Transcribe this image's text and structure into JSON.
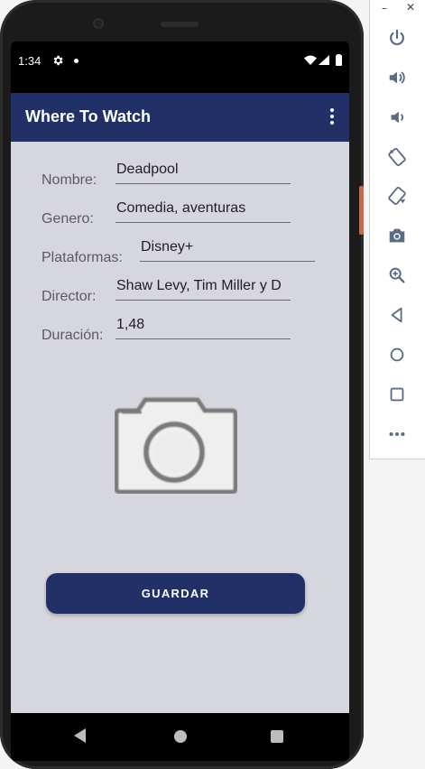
{
  "status_bar": {
    "time": "1:34"
  },
  "app_bar": {
    "title": "Where To Watch"
  },
  "form": {
    "nombre": {
      "label": "Nombre:",
      "value": "Deadpool"
    },
    "genero": {
      "label": "Genero:",
      "value": "Comedia, aventuras"
    },
    "plataformas": {
      "label": "Plataformas:",
      "value": "Disney+"
    },
    "director": {
      "label": "Director:",
      "value": "Shaw Levy, Tim Miller y D"
    },
    "duracion": {
      "label": "Duración:",
      "value": "1,48"
    }
  },
  "photo": {
    "icon": "camera-icon"
  },
  "save_button": {
    "label": "GUARDAR"
  },
  "colors": {
    "primary": "#223068",
    "background": "#d6d6df",
    "text": "#1e1e1e",
    "label": "#5b5b5b"
  },
  "emulator_toolbar": {
    "icons": [
      "power-icon",
      "volume-up-icon",
      "volume-down-icon",
      "rotate-left-icon",
      "rotate-right-icon",
      "camera-icon",
      "zoom-icon",
      "back-icon",
      "home-icon",
      "overview-icon",
      "more-icon"
    ]
  }
}
